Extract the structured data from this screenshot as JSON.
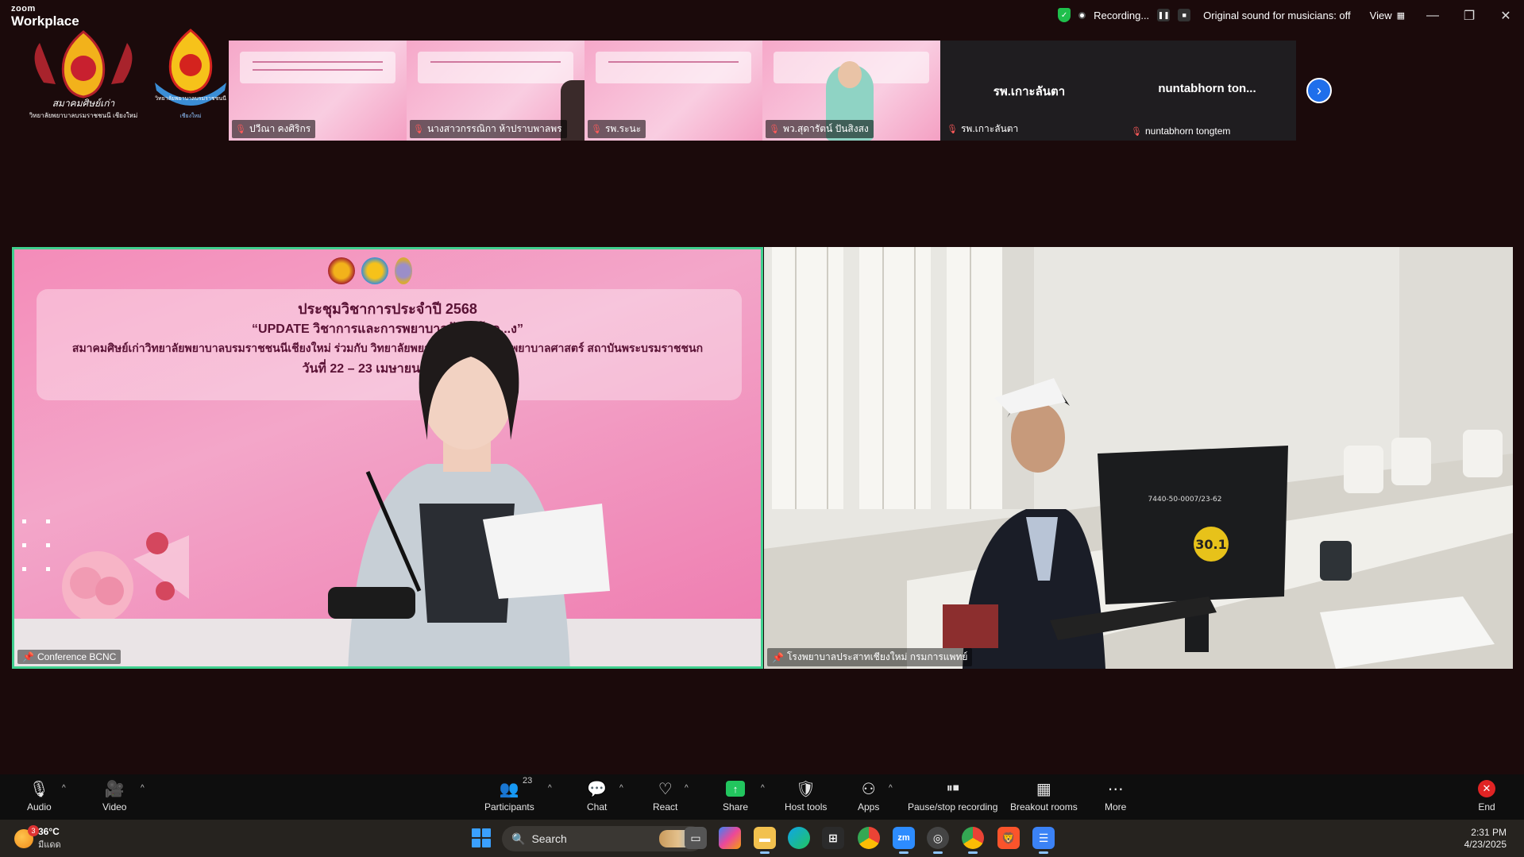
{
  "window": {
    "brand_top": "zoom",
    "brand_bottom": "Workplace",
    "recording_label": "Recording...",
    "original_sound": "Original sound for musicians: off",
    "view_label": "View"
  },
  "header_logos": {
    "logo1_text": "สมาคมศิษย์เก่า",
    "logo1_sub": "วิทยาลัยพยาบาลบรมราชชนนี เชียงใหม่",
    "logo2_text": "วิทยาลัยพยาบาลบรมราชชนนี",
    "logo2_sub": "เชียงใหม่"
  },
  "thumbnails": [
    {
      "name": "ปวีณา คงศิริกร",
      "type": "slide"
    },
    {
      "name": "นางสาวกรรณิกา ห้าปราบพาลพร",
      "type": "slide-person"
    },
    {
      "name": "รพ.ระนะ",
      "type": "slide"
    },
    {
      "name": "พว.สุดารัตน์ ปันสิงสง",
      "type": "person"
    },
    {
      "name": "รพ.เกาะลันตา",
      "big_name": "รพ.เกาะลันตา",
      "type": "dark"
    },
    {
      "name": "nuntabhorn tongtem",
      "big_name": "nuntabhorn ton...",
      "type": "dark"
    }
  ],
  "slide": {
    "line1": "ประชุมวิชาการประจำปี 2568",
    "line2": "“UPDATE วิชาการและการพยาบาลผู้ป่วยโรค...ง”",
    "line3": "สมาคมศิษย์เก่าวิทยาลัยพยาบาลบรมราชชนนีเชียงใหม่ ร่วมกับ วิทยาลัยพยาบาลบรมรา... ...ะพยาบาลศาสตร์ สถาบันพระบรมราชชนก",
    "line4": "วันที่ 22 – 23 เมษายน 2568 รู..."
  },
  "tiles": {
    "left_name": "Conference BCNC",
    "right_name": "โรงพยาบาลประสาทเชียงใหม่ กรมการแพทย์",
    "monitor_sticker": "30.1",
    "monitor_label": "7440-50-0007/23-62"
  },
  "toolbar": {
    "audio": "Audio",
    "video": "Video",
    "participants": "Participants",
    "participants_count": "23",
    "chat": "Chat",
    "react": "React",
    "share": "Share",
    "host_tools": "Host tools",
    "apps": "Apps",
    "pause_stop": "Pause/stop recording",
    "breakout": "Breakout rooms",
    "more": "More",
    "end": "End"
  },
  "taskbar": {
    "weather_badge": "3",
    "temperature": "36°C",
    "weather_desc": "มีแดด",
    "search_label": "Search",
    "time": "2:31 PM",
    "date": "4/23/2025"
  },
  "colors": {
    "active_speaker_border": "#3fcf8e",
    "record_green": "#1fbf4c",
    "end_red": "#e02424",
    "next_blue": "#1f6feb"
  }
}
